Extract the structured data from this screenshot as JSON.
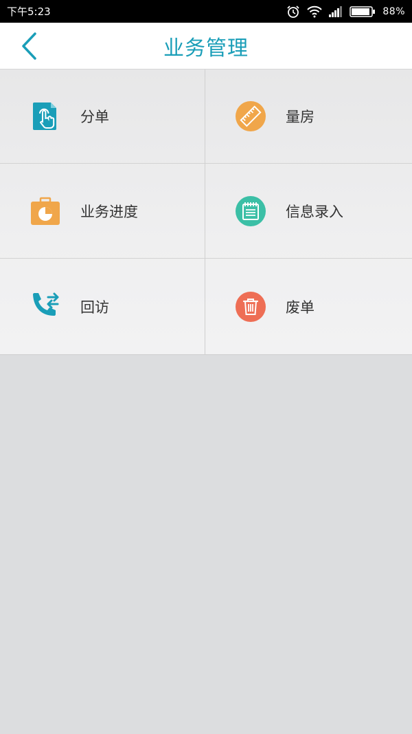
{
  "status_bar": {
    "time": "下午5:23",
    "battery": "88%",
    "icons": [
      "alarm-icon",
      "wifi-icon",
      "signal-icon",
      "battery-icon"
    ]
  },
  "header": {
    "title": "业务管理",
    "back_icon": "chevron-left-icon"
  },
  "menu": [
    {
      "label": "分单",
      "icon": "tap-hand-icon",
      "color": "#1a9eb8"
    },
    {
      "label": "量房",
      "icon": "ruler-icon",
      "color": "#f0a64a"
    },
    {
      "label": "业务进度",
      "icon": "briefcase-clock-icon",
      "color": "#f0a64a"
    },
    {
      "label": "信息录入",
      "icon": "notepad-icon",
      "color": "#3bbfa6"
    },
    {
      "label": "回访",
      "icon": "phone-arrows-icon",
      "color": "#1a9eb8"
    },
    {
      "label": "废单",
      "icon": "trash-icon",
      "color": "#ee6e55"
    }
  ]
}
